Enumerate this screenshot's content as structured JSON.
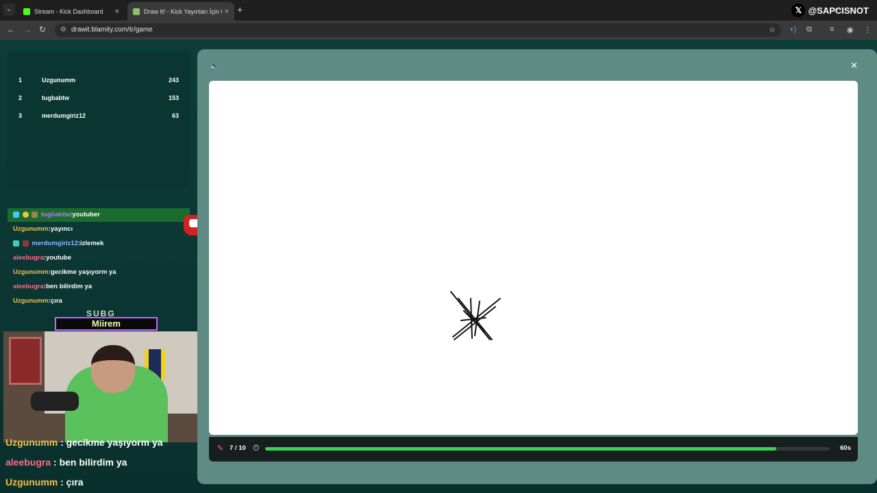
{
  "browser": {
    "tabs": [
      {
        "title": "Stream - Kick Dashboard",
        "active": false
      },
      {
        "title": "Draw It! - Kick Yayınları İçin Çizim",
        "active": true
      }
    ],
    "url": "drawit.blamity.com/tr/game",
    "overlay_handle": "@SAPCISNOT"
  },
  "leaderboard": [
    {
      "rank": "1",
      "name": "Uzgunumm",
      "points": "243"
    },
    {
      "rank": "2",
      "name": "tugbabtw",
      "points": "153"
    },
    {
      "rank": "3",
      "name": "merdumgiriz12",
      "points": "63"
    }
  ],
  "chat": [
    {
      "user": "tugbabtw",
      "sep": ":",
      "text": "youtuber",
      "color": "purple",
      "highlight": true
    },
    {
      "user": "Uzgunumm",
      "sep": ":",
      "text": "yayıncı",
      "color": "gold",
      "highlight": false
    },
    {
      "user": "merdumgiriz12",
      "sep": ":",
      "text": "izlemek",
      "color": "blue",
      "highlight": false
    },
    {
      "user": "aleebugra",
      "sep": ":",
      "text": "youtube",
      "color": "pink",
      "highlight": false
    },
    {
      "user": "Uzgunumm",
      "sep": ":",
      "text": "gecikme yaşıyorm ya",
      "color": "gold",
      "highlight": false
    },
    {
      "user": "aleebugra",
      "sep": ":",
      "text": "ben bilirdim ya",
      "color": "pink",
      "highlight": false
    },
    {
      "user": "Uzgunumm",
      "sep": ":",
      "text": "çıra",
      "color": "gold",
      "highlight": false
    }
  ],
  "sub_alert": {
    "tag": "SUBG",
    "name": "Miirem"
  },
  "stream_overlay": [
    {
      "user": "Uzgunumm",
      "sep": " : ",
      "text": "gecikme yaşıyorm ya",
      "color": "gold"
    },
    {
      "user": "aleebugra",
      "sep": " : ",
      "text": "ben bilirdim ya",
      "color": "pink"
    },
    {
      "user": "Uzgunumm",
      "sep": " : ",
      "text": "çıra",
      "color": "gold"
    }
  ],
  "game": {
    "round": "7 / 10",
    "timer": "60s",
    "progress": 0.905
  },
  "colors": {
    "accent_green": "#34d55a",
    "modal_bg": "#5f8b85",
    "page_bg": "#0d3d39"
  }
}
